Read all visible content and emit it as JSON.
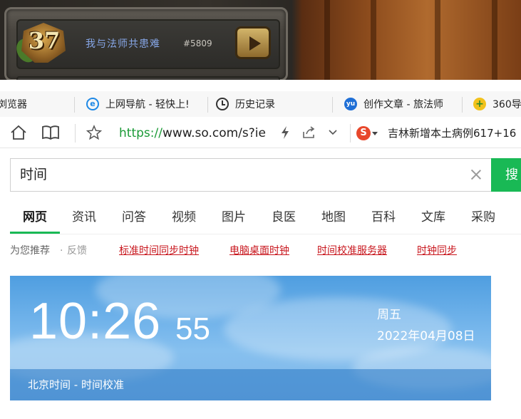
{
  "game_banner": {
    "level": "37",
    "player_name": "我与法师共患难",
    "player_tag": "#5809"
  },
  "bookmarks": [
    {
      "label": "浏览器",
      "icon": "none"
    },
    {
      "label": "上网导航 - 轻快上!",
      "icon": "ie-icon"
    },
    {
      "label": "历史记录",
      "icon": "clock-icon"
    },
    {
      "label": "创作文章 - 旅法师",
      "icon": "yu-icon"
    },
    {
      "label": "360导",
      "icon": "360-icon"
    }
  ],
  "toolbar": {
    "url_scheme": "https://",
    "url_rest": "www.so.com/s?ie",
    "search_engine_icon": "S",
    "news_text": "吉林新增本土病例617+16"
  },
  "search": {
    "query": "时间",
    "button_label": "搜"
  },
  "tabs": [
    "网页",
    "资讯",
    "问答",
    "视频",
    "图片",
    "良医",
    "地图",
    "百科",
    "文库",
    "采购"
  ],
  "recommendations": {
    "label": "为您推荐",
    "dot": "·",
    "feedback": "反馈",
    "links": [
      "标准时间同步时钟",
      "电脑桌面时钟",
      "时间校准服务器",
      "时钟同步"
    ]
  },
  "time_card": {
    "time": "10:26",
    "seconds": "55",
    "weekday": "周五",
    "date": "2022年04月08日",
    "footer": "北京时间 - 时间校准"
  }
}
